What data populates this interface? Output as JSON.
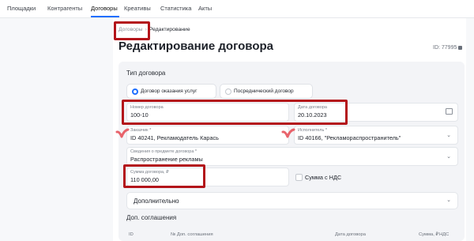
{
  "nav": {
    "tabs": [
      "Площадки",
      "Контрагенты",
      "Договоры",
      "Креативы",
      "Статистика",
      "Акты"
    ],
    "active": "Договоры"
  },
  "breadcrumb": {
    "parent": "Договоры",
    "current": "Редактирование"
  },
  "page": {
    "title": "Редактирование договора",
    "id_label": "ID: 77995"
  },
  "contract_type": {
    "title": "Тип договора",
    "options": [
      "Договор оказания услуг",
      "Посреднический договор"
    ],
    "selected": "Договор оказания услуг"
  },
  "fields": {
    "number": {
      "label": "Номер договора",
      "value": "100-10"
    },
    "date": {
      "label": "Дата договора",
      "value": "20.10.2023"
    },
    "customer": {
      "label": "Заказчик *",
      "value": "ID 40241, Рекламодатель Карась"
    },
    "executor": {
      "label": "Исполнитель *",
      "value": "ID 40166, \"Рекламораспространитель\""
    },
    "subject": {
      "label": "Сведения о предмете договора *",
      "value": "Распространение рекламы"
    },
    "amount": {
      "label": "Сумма договора, ₽",
      "value": "110 000,00"
    }
  },
  "vat_checkbox": {
    "label": "Сумма с НДС",
    "checked": false
  },
  "additional": {
    "label": "Дополнительно"
  },
  "agreements": {
    "title": "Доп. соглашения",
    "columns": [
      "ID",
      "№ Доп. соглашения",
      "Дата договора",
      "Сумма, ₽",
      "НДС"
    ]
  },
  "colors": {
    "accent": "#1e6fff",
    "highlight": "#b3141a",
    "mark": "#e8636b"
  }
}
